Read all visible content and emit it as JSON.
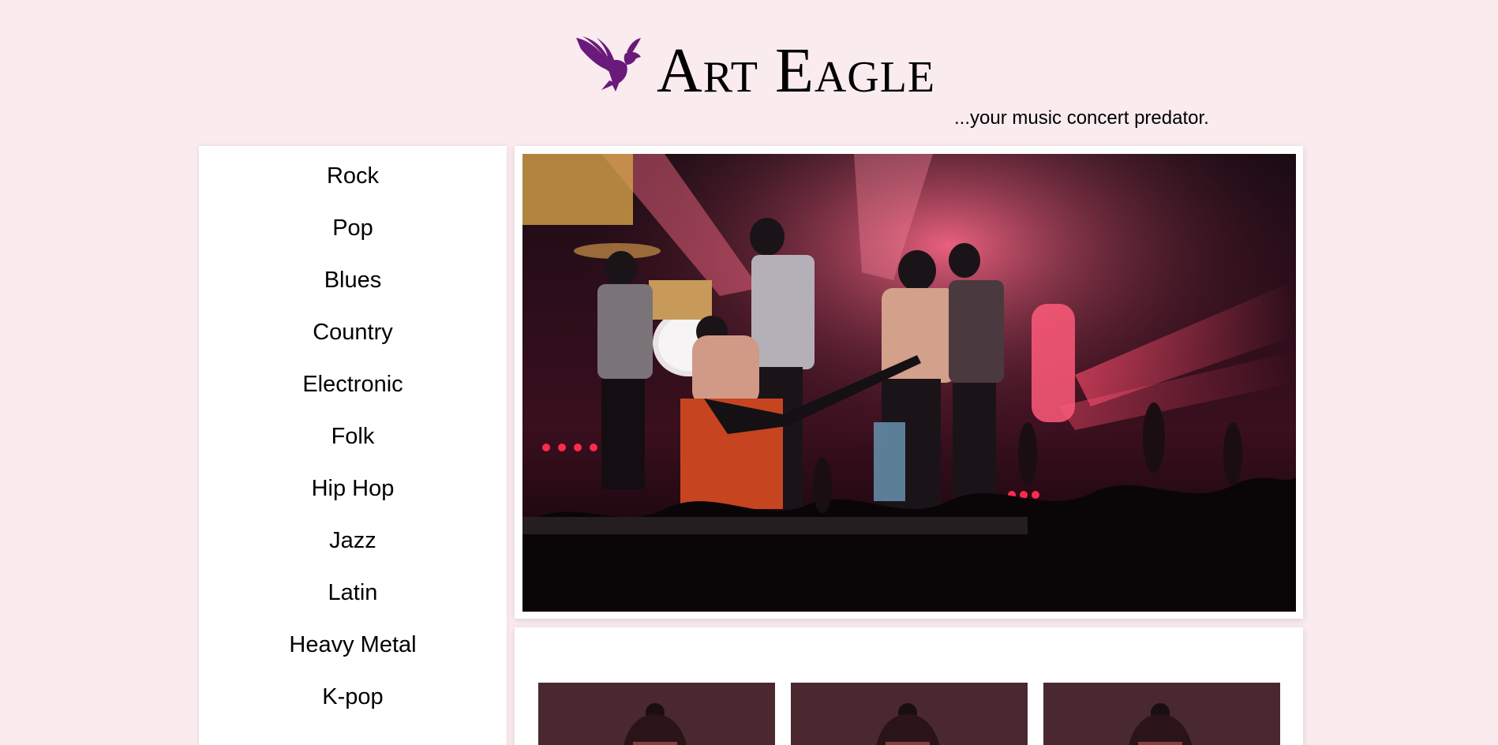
{
  "header": {
    "title": "Art Eagle",
    "tagline": "...your music concert predator.",
    "logo_icon": "eagle-icon",
    "logo_color": "#6a1a7a"
  },
  "sidebar": {
    "genres": [
      {
        "label": "Rock"
      },
      {
        "label": "Pop"
      },
      {
        "label": "Blues"
      },
      {
        "label": "Country"
      },
      {
        "label": "Electronic"
      },
      {
        "label": "Folk"
      },
      {
        "label": "Hip Hop"
      },
      {
        "label": "Jazz"
      },
      {
        "label": "Latin"
      },
      {
        "label": "Heavy Metal"
      },
      {
        "label": "K-pop"
      }
    ]
  },
  "colors": {
    "background": "#f9ebee",
    "card": "#ffffff",
    "accent": "#6a1a7a"
  },
  "hero": {
    "image_icon": "concert-photo"
  },
  "thumbnails": [
    {
      "image_icon": "concert-thumbnail"
    },
    {
      "image_icon": "concert-thumbnail"
    },
    {
      "image_icon": "concert-thumbnail"
    }
  ]
}
